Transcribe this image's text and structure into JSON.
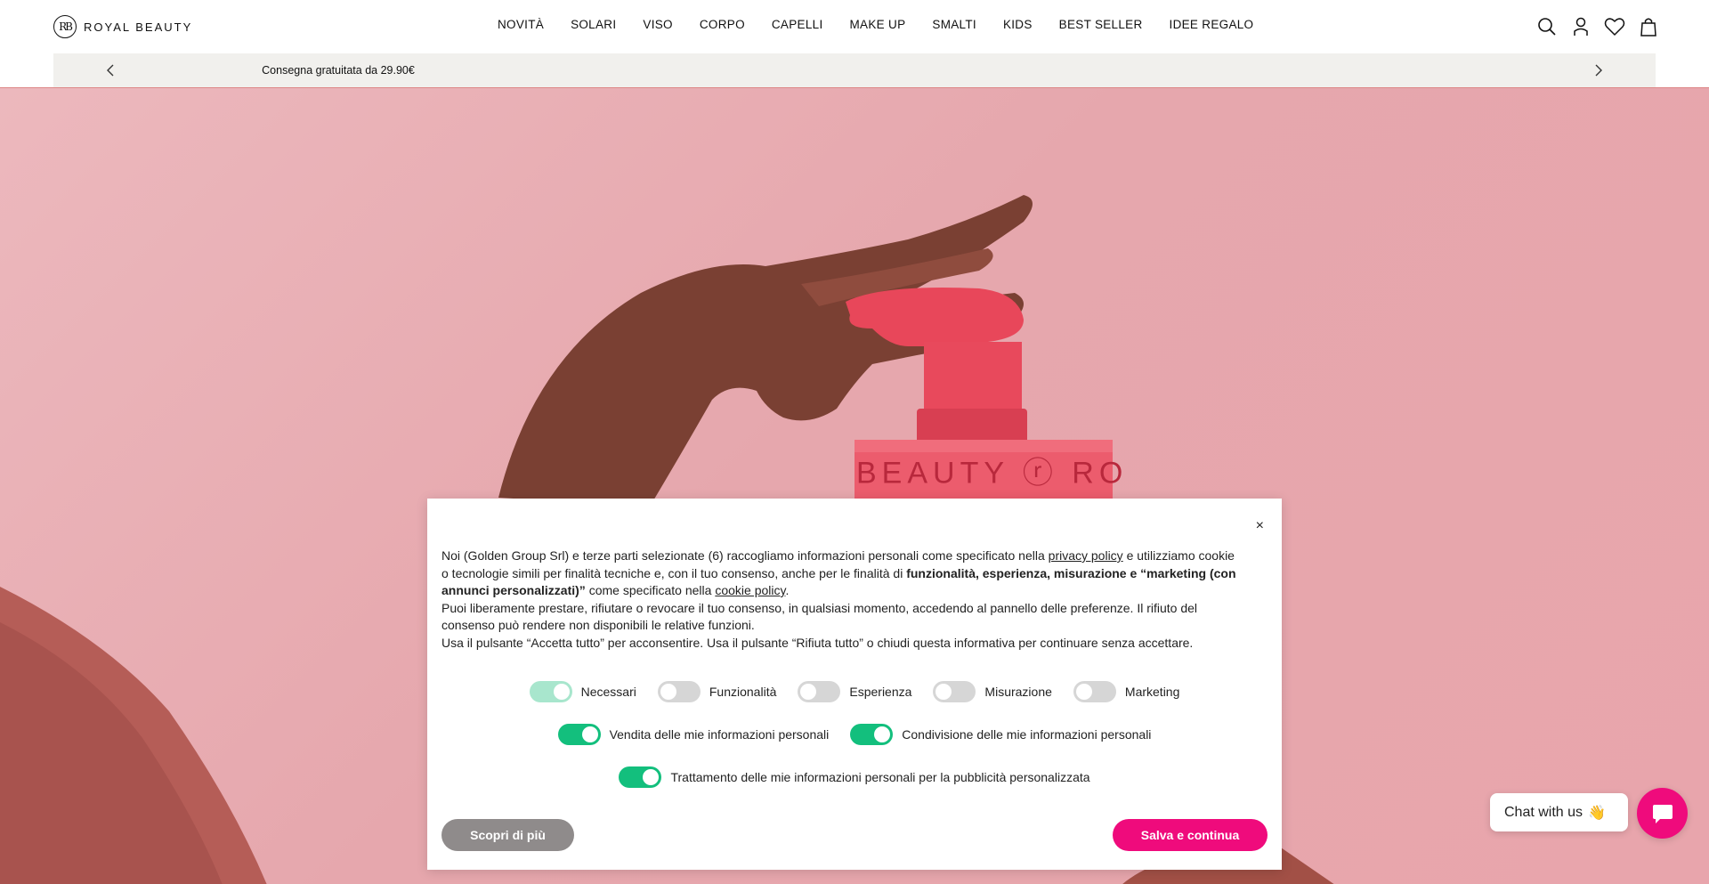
{
  "brand": {
    "name": "ROYAL BEAUTY",
    "monogram": "RB"
  },
  "nav": [
    {
      "label": "NOVITÀ"
    },
    {
      "label": "SOLARI"
    },
    {
      "label": "VISO"
    },
    {
      "label": "CORPO"
    },
    {
      "label": "CAPELLI"
    },
    {
      "label": "MAKE UP"
    },
    {
      "label": "SMALTI"
    },
    {
      "label": "KIDS"
    },
    {
      "label": "BEST SELLER"
    },
    {
      "label": "IDEE REGALO"
    }
  ],
  "header_icons": [
    "search-icon",
    "user-icon",
    "heart-icon",
    "bag-icon"
  ],
  "promo": {
    "text": "Consegna gratuitata da 29.90€"
  },
  "hero": {
    "bottle_text": "BEAUTY ⓡ RO"
  },
  "cookie": {
    "p1_a": "Noi (Golden Group Srl) e terze parti selezionate (6) raccogliamo informazioni personali come specificato nella ",
    "p1_link1": "privacy policy",
    "p1_b": " e utilizziamo cookie o tecnologie simili per finalità tecniche e, con il tuo consenso, anche per le finalità di ",
    "p1_bold": "funzionalità, esperienza, misurazione e “marketing (con annunci personalizzati)”",
    "p1_c": " come specificato nella ",
    "p1_link2": "cookie policy",
    "p1_d": ".",
    "p2": "Puoi liberamente prestare, rifiutare o revocare il tuo consenso, in qualsiasi momento, accedendo al pannello delle preferenze. Il rifiuto del consenso può rendere non disponibili le relative funzioni.",
    "p3": "Usa il pulsante “Accetta tutto” per acconsentire. Usa il pulsante “Rifiuta tutto” o chiudi questa informativa per continuare senza accettare.",
    "toggles_row1": [
      {
        "label": "Necessari",
        "state": "disabled-on"
      },
      {
        "label": "Funzionalità",
        "state": "off"
      },
      {
        "label": "Esperienza",
        "state": "off"
      },
      {
        "label": "Misurazione",
        "state": "off"
      },
      {
        "label": "Marketing",
        "state": "off"
      }
    ],
    "toggles_row2": [
      {
        "label": "Vendita delle mie informazioni personali",
        "state": "on"
      },
      {
        "label": "Condivisione delle mie informazioni personali",
        "state": "on"
      }
    ],
    "toggles_row3": [
      {
        "label": "Trattamento delle mie informazioni personali per la pubblicità personalizzata",
        "state": "on"
      }
    ],
    "btn_more": "Scopri di più",
    "btn_save": "Salva e continua",
    "close": "×"
  },
  "chat": {
    "label": "Chat with us",
    "emoji": "👋"
  },
  "colors": {
    "accent": "#ef0b7c",
    "toggle_on": "#13bf7d",
    "hero_bg": "#e6a7ad"
  }
}
